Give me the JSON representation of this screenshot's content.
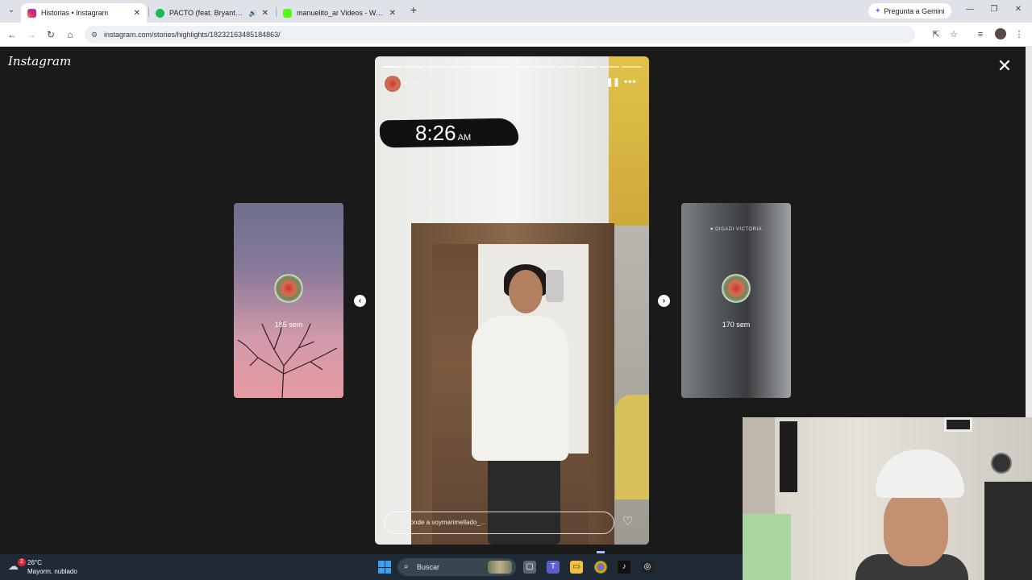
{
  "browser": {
    "tabs": [
      {
        "title": "Historias • Instagram",
        "active": true,
        "favicon_color": "#d62976"
      },
      {
        "title": "PACTO (feat. Bryant Myers &",
        "active": false,
        "favicon_color": "#1db954"
      },
      {
        "title": "manuelito_ar Videos - Watch O",
        "active": false,
        "favicon_color": "#53fc18"
      }
    ],
    "gemini_label": "Pregunta a Gemini",
    "url": "instagram.com/stories/highlights/18232163485184863/"
  },
  "instagram": {
    "logo": "Instagram",
    "left_preview": {
      "time": "185 sem"
    },
    "right_preview": {
      "time": "170 sem",
      "tag": "♥ DIGADI VICTORIA"
    },
    "story": {
      "age": "86 sem",
      "sticker_time": "8:26",
      "sticker_ampm": "AM",
      "reply_placeholder": "Responde a soymarimellado_...",
      "progress_total": 12,
      "progress_done": 1
    }
  },
  "taskbar": {
    "weather_temp": "26°C",
    "weather_desc": "Mayorm. nublado",
    "weather_badge": "2",
    "search_placeholder": "Buscar"
  }
}
